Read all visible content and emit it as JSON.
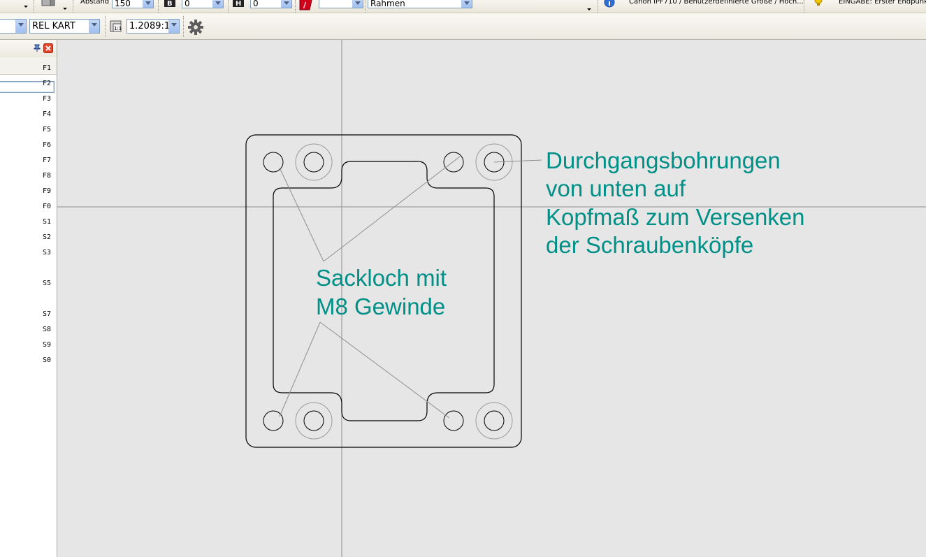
{
  "toolbar_top": {
    "abstand_label": "Abstand",
    "abstand_value": "150",
    "b_value": "0",
    "h_value": "0",
    "color_value": "",
    "layer_value": "Rahmen",
    "printer_text": "Canon iPF710 / Benutzerdefinierte Größe / Hoch...",
    "status_text": "EINGABE: Erster Endpunkt"
  },
  "toolbar_second": {
    "mode_value": "REL KART",
    "scale_value": "1.2089:1"
  },
  "left_panel": {
    "fkeys": [
      "F1",
      "F2",
      "F3",
      "F4",
      "F5",
      "F6",
      "F7",
      "F8",
      "F9",
      "F0",
      "S1",
      "S2",
      "S3",
      "S5",
      "S7",
      "S8",
      "S9",
      "S0"
    ]
  },
  "drawing": {
    "annotation_right": [
      "Durchgangsbohrungen",
      "von unten auf",
      "Kopfmaß zum Versenken",
      "der Schraubenköpfe"
    ],
    "annotation_center": [
      "Sackloch mit",
      "M8 Gewinde"
    ],
    "note_color": "#009088"
  }
}
